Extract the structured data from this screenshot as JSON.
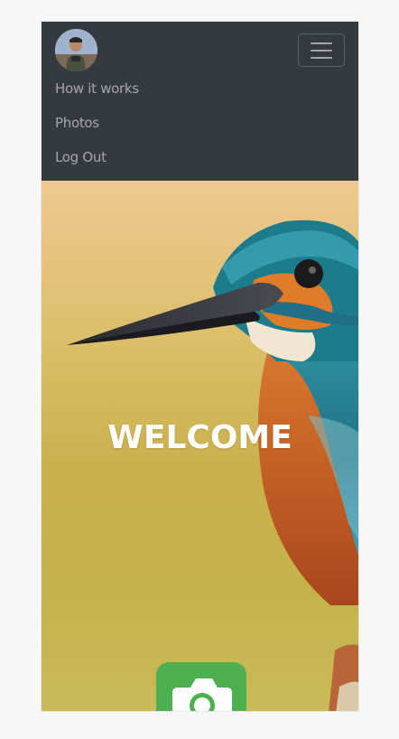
{
  "navbar": {
    "bg_color": "#343a40",
    "avatar_icon": "user-avatar",
    "menu_icon": "hamburger-menu-icon",
    "links": [
      {
        "label": "How it works"
      },
      {
        "label": "Photos"
      },
      {
        "label": "Log Out"
      }
    ]
  },
  "hero": {
    "title": "WELCOME",
    "image_icon": "kingfisher-bird-photo",
    "camera_icon": "camera-icon",
    "camera_color": "#4caf50"
  }
}
